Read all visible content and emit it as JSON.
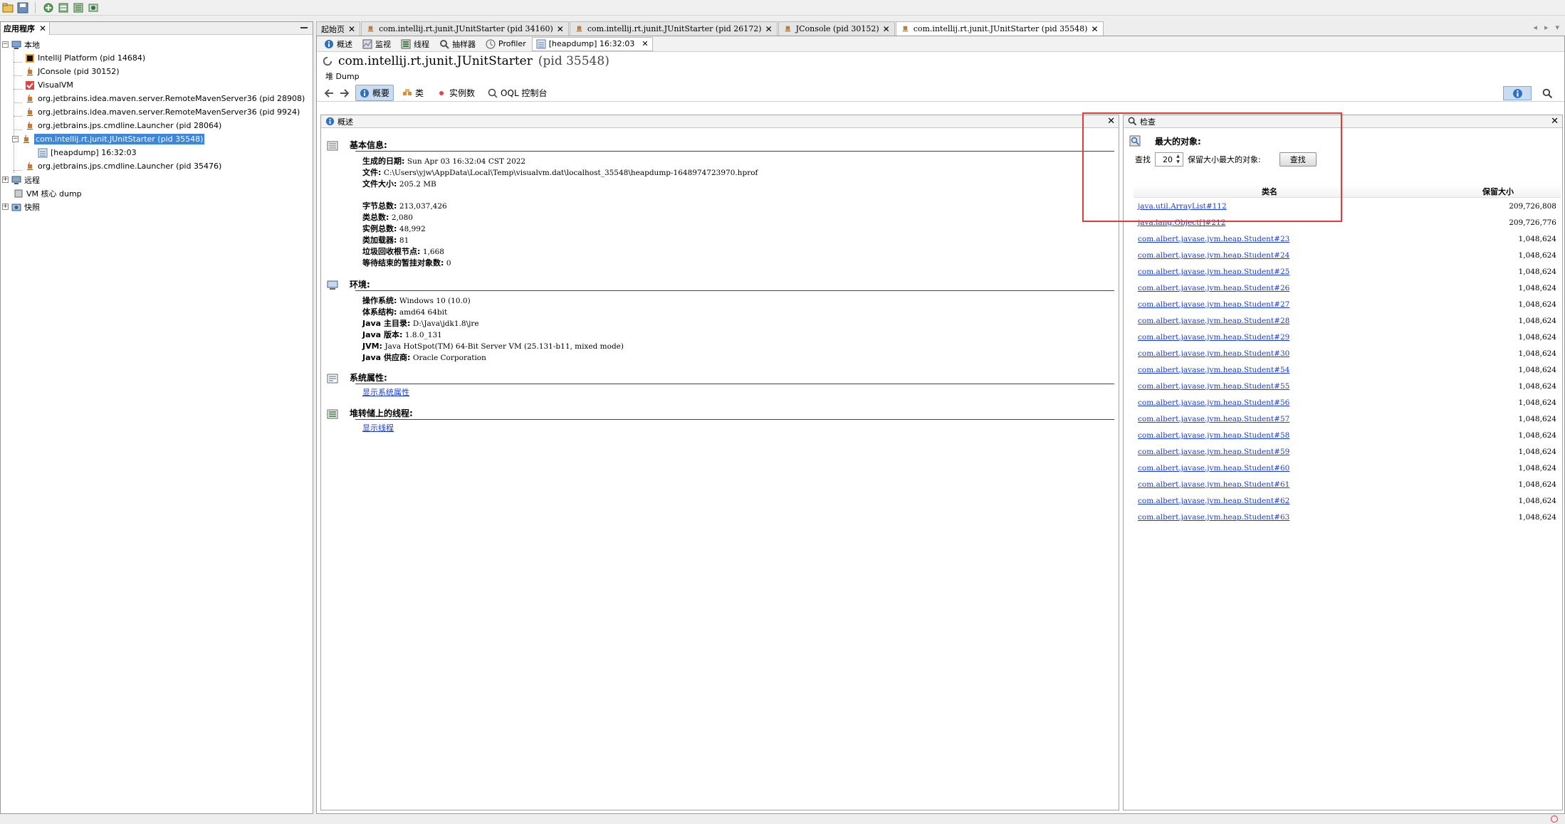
{
  "toolbar": {
    "buttons": [
      "open-snapshot-icon",
      "save-icon",
      "add-jmx-connection-icon",
      "heap-dump-icon",
      "thread-dump-icon",
      "snapshot-icon"
    ]
  },
  "left_panel": {
    "tab_label": "应用程序",
    "tree": {
      "local": "本地",
      "local_items": [
        "IntelliJ Platform (pid 14684)",
        "JConsole (pid 30152)",
        "VisualVM",
        "org.jetbrains.idea.maven.server.RemoteMavenServer36 (pid 28908)",
        "org.jetbrains.idea.maven.server.RemoteMavenServer36 (pid 9924)",
        "org.jetbrains.jps.cmdline.Launcher (pid 28064)",
        "com.intellij.rt.junit.JUnitStarter (pid 35548)",
        "org.jetbrains.jps.cmdline.Launcher (pid 35476)"
      ],
      "heapdump_child": "[heapdump] 16:32:03",
      "remote": "远程",
      "vm_coredump": "VM 核心 dump",
      "snapshots": "快照"
    }
  },
  "doc_tabs": [
    "起始页",
    "com.intellij.rt.junit.JUnitStarter (pid 34160)",
    "com.intellij.rt.junit.JUnitStarter (pid 26172)",
    "JConsole (pid 30152)",
    "com.intellij.rt.junit.JUnitStarter (pid 35548)"
  ],
  "sub_tabs": [
    "概述",
    "监视",
    "线程",
    "抽样器",
    "Profiler",
    "[heapdump] 16:32:03"
  ],
  "header": {
    "title": "com.intellij.rt.junit.JUnitStarter",
    "pid": "(pid 35548)",
    "heap_label": "堆 Dump"
  },
  "views": [
    "概要",
    "类",
    "实例数",
    "OQL 控制台"
  ],
  "summary": {
    "pane_title": "概述",
    "basic_title": "基本信息:",
    "basic_a": [
      {
        "k": "生成的日期:",
        "v": "Sun Apr 03 16:32:04 CST 2022"
      },
      {
        "k": "文件:",
        "v": "C:\\Users\\yjw\\AppData\\Local\\Temp\\visualvm.dat\\localhost_35548\\heapdump-1648974723970.hprof"
      },
      {
        "k": "文件大小:",
        "v": "205.2 MB"
      }
    ],
    "basic_b": [
      {
        "k": "字节总数:",
        "v": "213,037,426"
      },
      {
        "k": "类总数:",
        "v": "2,080"
      },
      {
        "k": "实例总数:",
        "v": "48,992"
      },
      {
        "k": "类加载器:",
        "v": "81"
      },
      {
        "k": "垃圾回收根节点:",
        "v": "1,668"
      },
      {
        "k": "等待结束的暂挂对象数:",
        "v": "0"
      }
    ],
    "env_title": "环境:",
    "env": [
      {
        "k": "操作系统:",
        "v": "Windows 10 (10.0)"
      },
      {
        "k": "体系结构:",
        "v": "amd64 64bit"
      },
      {
        "k": "Java 主目录:",
        "v": "D:\\Java\\jdk1.8\\jre"
      },
      {
        "k": "Java 版本:",
        "v": "1.8.0_131"
      },
      {
        "k": "JVM:",
        "v": "Java HotSpot(TM) 64-Bit Server VM (25.131-b11, mixed mode)"
      },
      {
        "k": "Java 供应商:",
        "v": "Oracle Corporation"
      }
    ],
    "sysprops_title": "系统属性:",
    "sysprops_link": "显示系统属性",
    "threads_title": "堆转储上的线程:",
    "threads_link": "显示线程"
  },
  "inspect": {
    "pane_title": "检查",
    "section_title": "最大的对象:",
    "find_label": "查找",
    "count": "20",
    "count_suffix": "保留大小最大的对象:",
    "find_button": "查找",
    "col_class": "类名",
    "col_retained": "保留大小",
    "rows": [
      {
        "name": "java.util.ArrayList#112",
        "size": "209,726,808"
      },
      {
        "name": "java.lang.Object[]#212",
        "size": "209,726,776"
      },
      {
        "name": "com.albert.javase.jvm.heap.Student#23",
        "size": "1,048,624"
      },
      {
        "name": "com.albert.javase.jvm.heap.Student#24",
        "size": "1,048,624"
      },
      {
        "name": "com.albert.javase.jvm.heap.Student#25",
        "size": "1,048,624"
      },
      {
        "name": "com.albert.javase.jvm.heap.Student#26",
        "size": "1,048,624"
      },
      {
        "name": "com.albert.javase.jvm.heap.Student#27",
        "size": "1,048,624"
      },
      {
        "name": "com.albert.javase.jvm.heap.Student#28",
        "size": "1,048,624"
      },
      {
        "name": "com.albert.javase.jvm.heap.Student#29",
        "size": "1,048,624"
      },
      {
        "name": "com.albert.javase.jvm.heap.Student#30",
        "size": "1,048,624"
      },
      {
        "name": "com.albert.javase.jvm.heap.Student#54",
        "size": "1,048,624"
      },
      {
        "name": "com.albert.javase.jvm.heap.Student#55",
        "size": "1,048,624"
      },
      {
        "name": "com.albert.javase.jvm.heap.Student#56",
        "size": "1,048,624"
      },
      {
        "name": "com.albert.javase.jvm.heap.Student#57",
        "size": "1,048,624"
      },
      {
        "name": "com.albert.javase.jvm.heap.Student#58",
        "size": "1,048,624"
      },
      {
        "name": "com.albert.javase.jvm.heap.Student#59",
        "size": "1,048,624"
      },
      {
        "name": "com.albert.javase.jvm.heap.Student#60",
        "size": "1,048,624"
      },
      {
        "name": "com.albert.javase.jvm.heap.Student#61",
        "size": "1,048,624"
      },
      {
        "name": "com.albert.javase.jvm.heap.Student#62",
        "size": "1,048,624"
      },
      {
        "name": "com.albert.javase.jvm.heap.Student#63",
        "size": "1,048,624"
      }
    ]
  },
  "colors": {
    "selection": "#3d86d8",
    "link": "#1b3ccb",
    "highlight_box": "#e23b3b",
    "active_tool": "#c9dcf2"
  }
}
